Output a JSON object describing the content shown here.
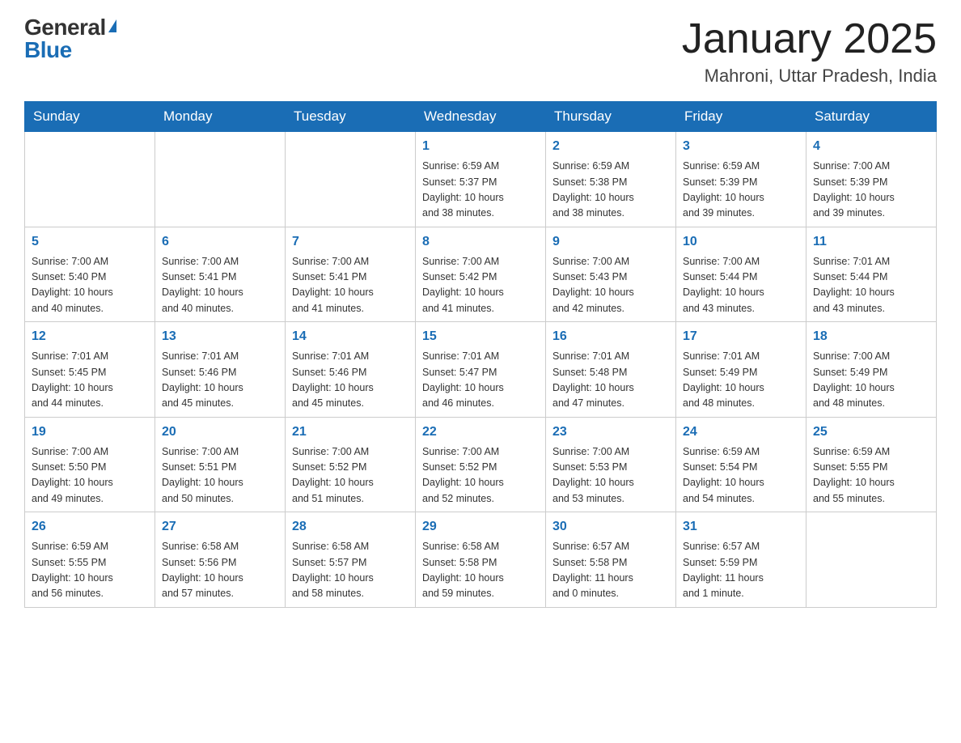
{
  "header": {
    "logo_general": "General",
    "logo_blue": "Blue",
    "month_year": "January 2025",
    "location": "Mahroni, Uttar Pradesh, India"
  },
  "days_of_week": [
    "Sunday",
    "Monday",
    "Tuesday",
    "Wednesday",
    "Thursday",
    "Friday",
    "Saturday"
  ],
  "weeks": [
    [
      {
        "day": "",
        "info": ""
      },
      {
        "day": "",
        "info": ""
      },
      {
        "day": "",
        "info": ""
      },
      {
        "day": "1",
        "info": "Sunrise: 6:59 AM\nSunset: 5:37 PM\nDaylight: 10 hours\nand 38 minutes."
      },
      {
        "day": "2",
        "info": "Sunrise: 6:59 AM\nSunset: 5:38 PM\nDaylight: 10 hours\nand 38 minutes."
      },
      {
        "day": "3",
        "info": "Sunrise: 6:59 AM\nSunset: 5:39 PM\nDaylight: 10 hours\nand 39 minutes."
      },
      {
        "day": "4",
        "info": "Sunrise: 7:00 AM\nSunset: 5:39 PM\nDaylight: 10 hours\nand 39 minutes."
      }
    ],
    [
      {
        "day": "5",
        "info": "Sunrise: 7:00 AM\nSunset: 5:40 PM\nDaylight: 10 hours\nand 40 minutes."
      },
      {
        "day": "6",
        "info": "Sunrise: 7:00 AM\nSunset: 5:41 PM\nDaylight: 10 hours\nand 40 minutes."
      },
      {
        "day": "7",
        "info": "Sunrise: 7:00 AM\nSunset: 5:41 PM\nDaylight: 10 hours\nand 41 minutes."
      },
      {
        "day": "8",
        "info": "Sunrise: 7:00 AM\nSunset: 5:42 PM\nDaylight: 10 hours\nand 41 minutes."
      },
      {
        "day": "9",
        "info": "Sunrise: 7:00 AM\nSunset: 5:43 PM\nDaylight: 10 hours\nand 42 minutes."
      },
      {
        "day": "10",
        "info": "Sunrise: 7:00 AM\nSunset: 5:44 PM\nDaylight: 10 hours\nand 43 minutes."
      },
      {
        "day": "11",
        "info": "Sunrise: 7:01 AM\nSunset: 5:44 PM\nDaylight: 10 hours\nand 43 minutes."
      }
    ],
    [
      {
        "day": "12",
        "info": "Sunrise: 7:01 AM\nSunset: 5:45 PM\nDaylight: 10 hours\nand 44 minutes."
      },
      {
        "day": "13",
        "info": "Sunrise: 7:01 AM\nSunset: 5:46 PM\nDaylight: 10 hours\nand 45 minutes."
      },
      {
        "day": "14",
        "info": "Sunrise: 7:01 AM\nSunset: 5:46 PM\nDaylight: 10 hours\nand 45 minutes."
      },
      {
        "day": "15",
        "info": "Sunrise: 7:01 AM\nSunset: 5:47 PM\nDaylight: 10 hours\nand 46 minutes."
      },
      {
        "day": "16",
        "info": "Sunrise: 7:01 AM\nSunset: 5:48 PM\nDaylight: 10 hours\nand 47 minutes."
      },
      {
        "day": "17",
        "info": "Sunrise: 7:01 AM\nSunset: 5:49 PM\nDaylight: 10 hours\nand 48 minutes."
      },
      {
        "day": "18",
        "info": "Sunrise: 7:00 AM\nSunset: 5:49 PM\nDaylight: 10 hours\nand 48 minutes."
      }
    ],
    [
      {
        "day": "19",
        "info": "Sunrise: 7:00 AM\nSunset: 5:50 PM\nDaylight: 10 hours\nand 49 minutes."
      },
      {
        "day": "20",
        "info": "Sunrise: 7:00 AM\nSunset: 5:51 PM\nDaylight: 10 hours\nand 50 minutes."
      },
      {
        "day": "21",
        "info": "Sunrise: 7:00 AM\nSunset: 5:52 PM\nDaylight: 10 hours\nand 51 minutes."
      },
      {
        "day": "22",
        "info": "Sunrise: 7:00 AM\nSunset: 5:52 PM\nDaylight: 10 hours\nand 52 minutes."
      },
      {
        "day": "23",
        "info": "Sunrise: 7:00 AM\nSunset: 5:53 PM\nDaylight: 10 hours\nand 53 minutes."
      },
      {
        "day": "24",
        "info": "Sunrise: 6:59 AM\nSunset: 5:54 PM\nDaylight: 10 hours\nand 54 minutes."
      },
      {
        "day": "25",
        "info": "Sunrise: 6:59 AM\nSunset: 5:55 PM\nDaylight: 10 hours\nand 55 minutes."
      }
    ],
    [
      {
        "day": "26",
        "info": "Sunrise: 6:59 AM\nSunset: 5:55 PM\nDaylight: 10 hours\nand 56 minutes."
      },
      {
        "day": "27",
        "info": "Sunrise: 6:58 AM\nSunset: 5:56 PM\nDaylight: 10 hours\nand 57 minutes."
      },
      {
        "day": "28",
        "info": "Sunrise: 6:58 AM\nSunset: 5:57 PM\nDaylight: 10 hours\nand 58 minutes."
      },
      {
        "day": "29",
        "info": "Sunrise: 6:58 AM\nSunset: 5:58 PM\nDaylight: 10 hours\nand 59 minutes."
      },
      {
        "day": "30",
        "info": "Sunrise: 6:57 AM\nSunset: 5:58 PM\nDaylight: 11 hours\nand 0 minutes."
      },
      {
        "day": "31",
        "info": "Sunrise: 6:57 AM\nSunset: 5:59 PM\nDaylight: 11 hours\nand 1 minute."
      },
      {
        "day": "",
        "info": ""
      }
    ]
  ]
}
